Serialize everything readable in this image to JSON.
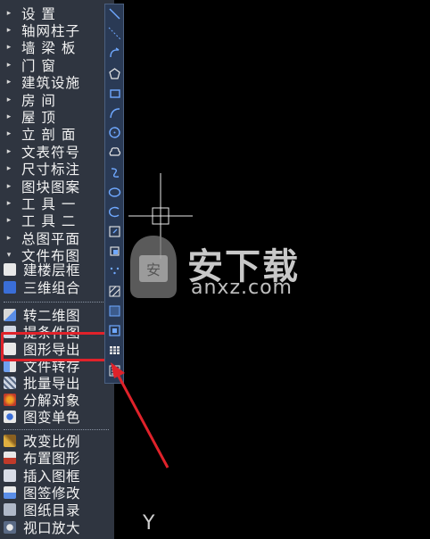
{
  "menu": {
    "items": [
      {
        "label": "设    置",
        "arrow": "▸"
      },
      {
        "label": "轴网柱子",
        "arrow": "▸"
      },
      {
        "label": "墙 梁 板",
        "arrow": "▸"
      },
      {
        "label": "门    窗",
        "arrow": "▸"
      },
      {
        "label": "建筑设施",
        "arrow": "▸"
      },
      {
        "label": "房    间",
        "arrow": "▸"
      },
      {
        "label": "屋    顶",
        "arrow": "▸"
      },
      {
        "label": "立 剖 面",
        "arrow": "▸"
      },
      {
        "label": "文表符号",
        "arrow": "▸"
      },
      {
        "label": "尺寸标注",
        "arrow": "▸"
      },
      {
        "label": "图块图案",
        "arrow": "▸"
      },
      {
        "label": "工 具 一",
        "arrow": "▸"
      },
      {
        "label": "工 具 二",
        "arrow": "▸"
      },
      {
        "label": "总图平面",
        "arrow": "▸"
      },
      {
        "label": "文件布图",
        "arrow": "▾"
      }
    ],
    "subgroup_a": [
      {
        "label": "建楼层框",
        "icon": "floor-frame-icon"
      },
      {
        "label": "三维组合",
        "icon": "3d-combine-icon"
      }
    ],
    "subgroup_b": [
      {
        "label": "转二维图",
        "icon": "to-2d-icon"
      },
      {
        "label": "提条件图",
        "icon": "condition-map-icon"
      },
      {
        "label": "图形导出",
        "icon": "graphic-export-icon"
      },
      {
        "label": "文件转存",
        "icon": "file-save-icon"
      },
      {
        "label": "批量导出",
        "icon": "batch-export-icon"
      },
      {
        "label": "分解对象",
        "icon": "explode-object-icon"
      },
      {
        "label": "图变单色",
        "icon": "monochrome-icon"
      }
    ],
    "subgroup_c": [
      {
        "label": "改变比例",
        "icon": "change-scale-icon"
      },
      {
        "label": "布置图形",
        "icon": "arrange-graphic-icon"
      },
      {
        "label": "插入图框",
        "icon": "insert-frame-icon"
      },
      {
        "label": "图签修改",
        "icon": "title-block-icon"
      },
      {
        "label": "图纸目录",
        "icon": "drawing-list-icon"
      },
      {
        "label": "视口放大",
        "icon": "viewport-zoom-icon"
      }
    ]
  },
  "toolbar": {
    "tools": [
      "line-icon",
      "construction-line-icon",
      "polyline-icon",
      "polygon-icon",
      "rectangle-icon",
      "arc-icon",
      "circle-icon",
      "revision-cloud-icon",
      "spline-icon",
      "ellipse-icon",
      "ellipse-arc-icon",
      "insert-block-icon",
      "make-block-icon",
      "point-icon",
      "hatch-icon",
      "gradient-icon",
      "region-icon",
      "table-icon",
      "multiline-text-icon"
    ]
  },
  "watermark": {
    "text": "安下载",
    "sub": "anxz.com"
  },
  "canvas": {
    "axis_label": "Y"
  },
  "colors": {
    "sidebar_bg": "#2f3540",
    "toolbar_bg": "#2a3a55",
    "highlight": "#e0222a",
    "canvas_bg": "#000000"
  }
}
